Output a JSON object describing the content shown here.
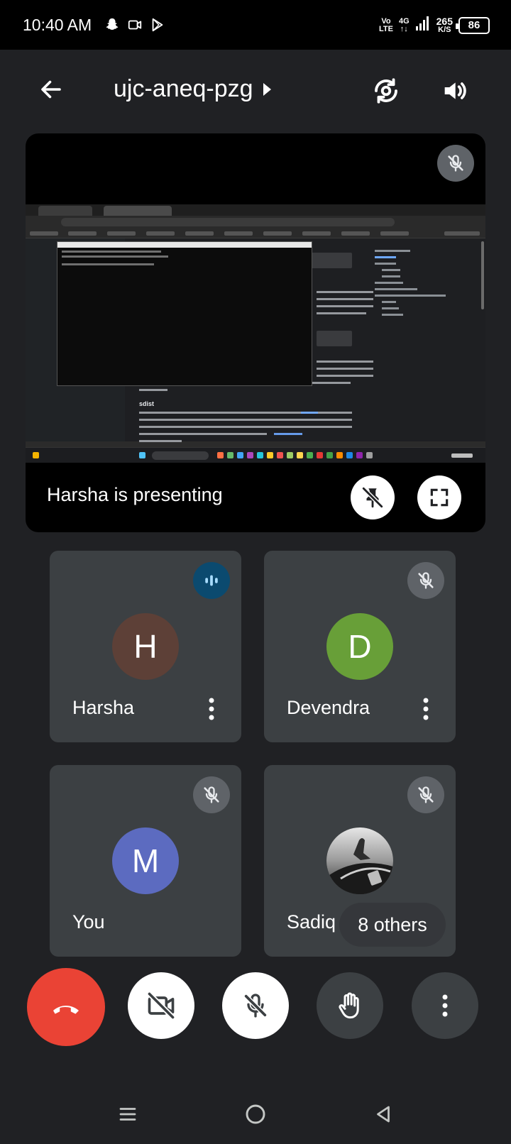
{
  "status_bar": {
    "time": "10:40 AM",
    "network_vo": "Vo",
    "network_lte": "LTE",
    "network_4g": "4G",
    "speed_value": "265",
    "speed_unit": "K/S",
    "battery": "86"
  },
  "header": {
    "meeting_code": "ujc-aneq-pzg"
  },
  "presentation": {
    "label": "Harsha is presenting",
    "screen_heading": "sdist"
  },
  "participants": [
    {
      "name": "Harsha",
      "initial": "H",
      "avatar_color": "#5d4037",
      "status": "speaking"
    },
    {
      "name": "Devendra",
      "initial": "D",
      "avatar_color": "#689f38",
      "status": "muted"
    },
    {
      "name": "You",
      "initial": "M",
      "avatar_color": "#5c6bc0",
      "status": "muted"
    },
    {
      "name": "Sadiq",
      "initial": "",
      "avatar_color": "#222222",
      "status": "muted"
    }
  ],
  "others_label": "8 others",
  "colors": {
    "end_call": "#ea4335",
    "tile_bg": "#3c4043",
    "background": "#202124",
    "speaking_indicator": "#0b4a6f"
  }
}
